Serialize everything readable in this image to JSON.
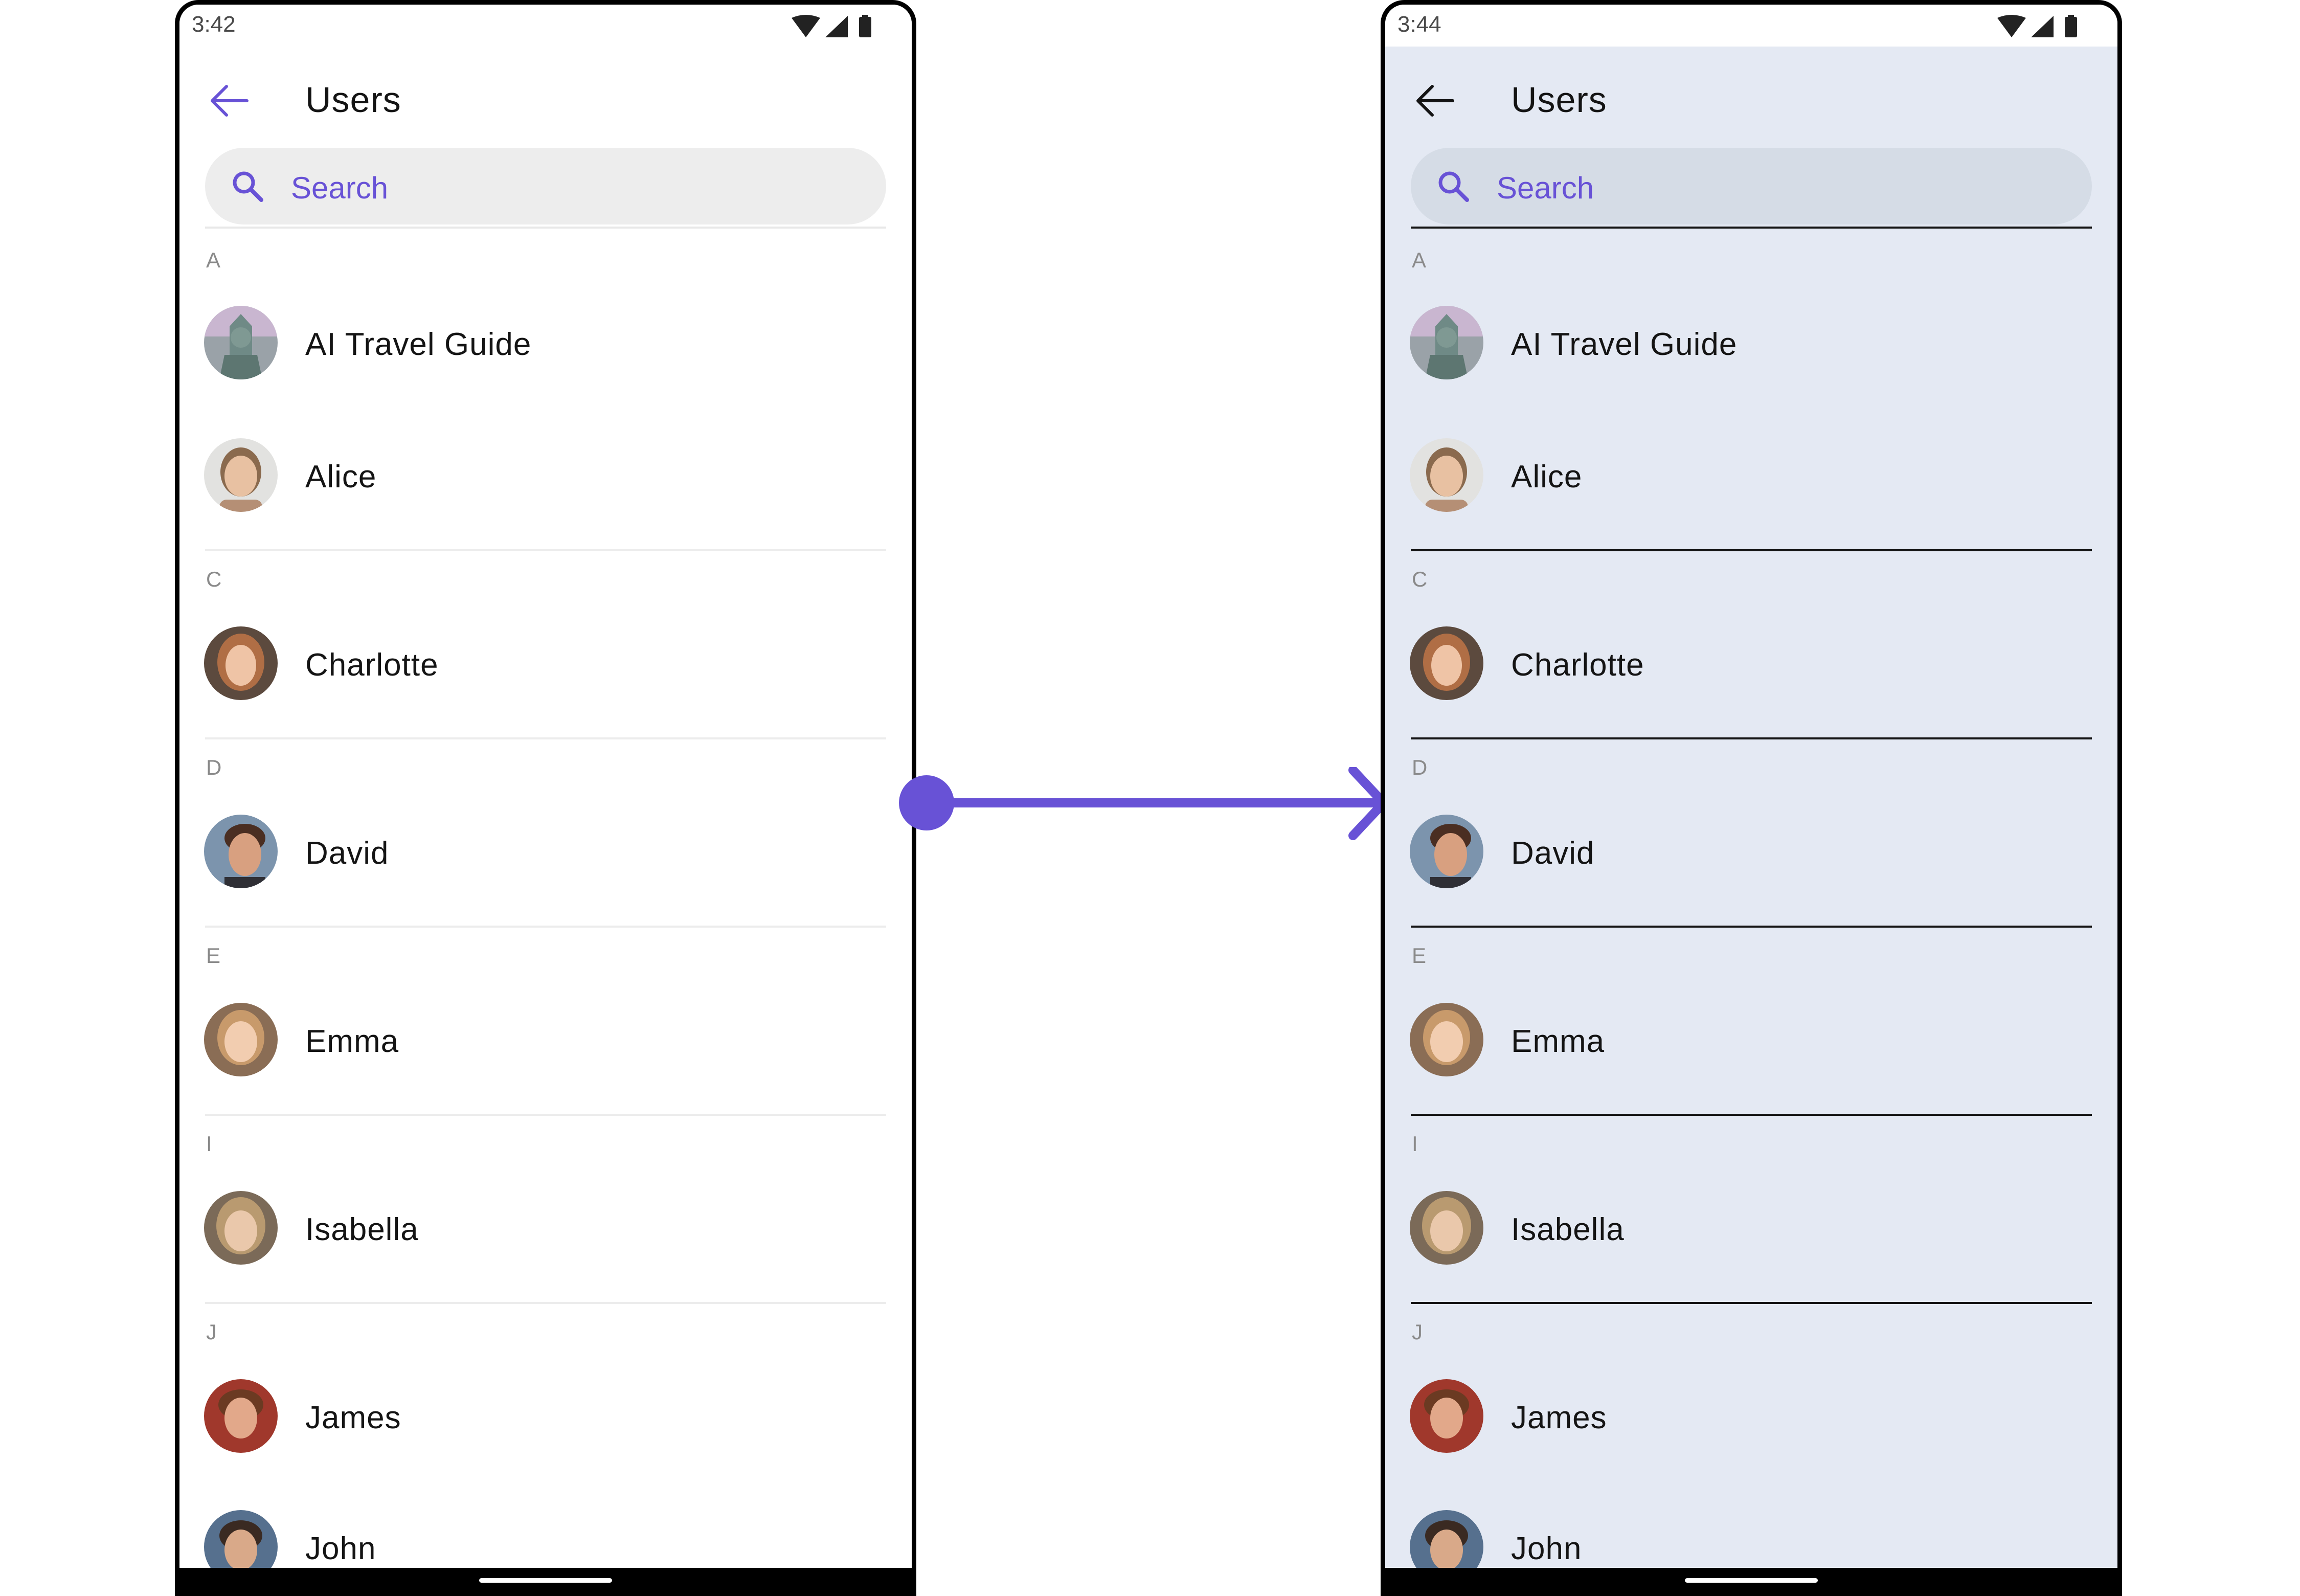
{
  "left": {
    "time": "3:42",
    "title": "Users",
    "search_placeholder": "Search",
    "sections": [
      "A",
      "C",
      "D",
      "E",
      "I",
      "J"
    ],
    "contacts": [
      "AI Travel Guide",
      "Alice",
      "Charlotte",
      "David",
      "Emma",
      "Isabella",
      "James",
      "John"
    ]
  },
  "right": {
    "time": "3:44",
    "title": "Users",
    "search_placeholder": "Search",
    "sections": [
      "A",
      "C",
      "D",
      "E",
      "I",
      "J"
    ],
    "contacts": [
      "AI Travel Guide",
      "Alice",
      "Charlotte",
      "David",
      "Emma",
      "Isabella",
      "James",
      "John"
    ]
  },
  "icons": {
    "back": "arrow-left-icon",
    "search": "magnifier-icon",
    "wifi": "wifi-icon",
    "signal": "signal-icon",
    "battery": "battery-icon",
    "connector": "right-arrow-connector"
  },
  "colors": {
    "accent": "#6852d6",
    "left_background": "#ffffff",
    "right_background": "#e4e9f3",
    "left_search": "#ededed",
    "right_search": "#d5dce6",
    "text": "#141414",
    "section_header": "#8a8a8a"
  }
}
